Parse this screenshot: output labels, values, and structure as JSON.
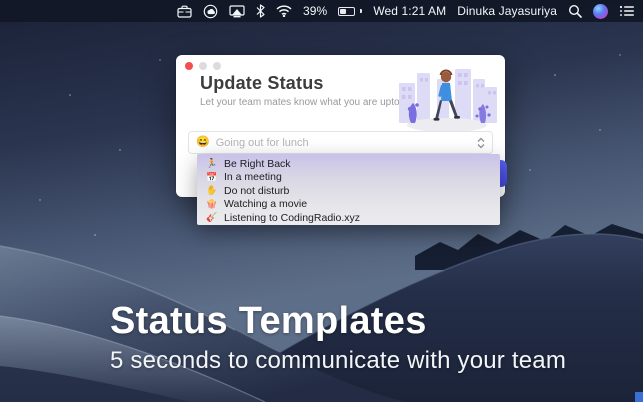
{
  "menu_bar": {
    "battery_percent": "39%",
    "clock": "Wed 1:21 AM",
    "user_name": "Dinuka Jayasuriya",
    "icons": [
      "briefcase-icon",
      "creative-cloud-icon",
      "display-mirroring-icon",
      "bluetooth-icon",
      "wifi-icon",
      "battery-icon",
      "search-icon",
      "siri-icon",
      "notification-list-icon"
    ]
  },
  "window": {
    "title": "Update Status",
    "subtitle": "Let your team mates know what you are upto",
    "status_input": {
      "emoji": "😄",
      "placeholder": "Going out for lunch"
    },
    "dropdown": {
      "items": [
        {
          "emoji": "🏃",
          "label": "Be Right Back"
        },
        {
          "emoji": "📅",
          "label": "In a meeting"
        },
        {
          "emoji": "✋",
          "label": "Do not disturb"
        },
        {
          "emoji": "🍿",
          "label": "Watching a movie"
        },
        {
          "emoji": "🎸",
          "label": "Listening to CodingRadio.xyz"
        }
      ]
    }
  },
  "hero": {
    "title": "Status Templates",
    "subtitle": "5 seconds to communicate with your team"
  },
  "colors": {
    "accent_button": "#4a52e8",
    "menu_bar_bg": "#121827",
    "dropdown_top": "#c8c2ea",
    "illustration_purple": "#7b6fe0",
    "wallpaper_sky_top": "#1a2136",
    "wallpaper_dune_dark": "#222c44"
  }
}
